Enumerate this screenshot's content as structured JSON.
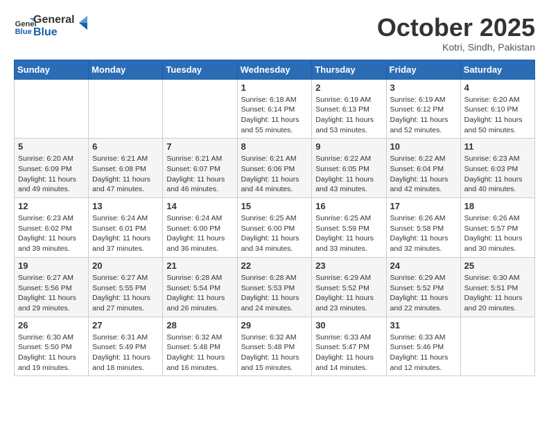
{
  "header": {
    "logo_line1": "General",
    "logo_line2": "Blue",
    "month": "October 2025",
    "location": "Kotri, Sindh, Pakistan"
  },
  "weekdays": [
    "Sunday",
    "Monday",
    "Tuesday",
    "Wednesday",
    "Thursday",
    "Friday",
    "Saturday"
  ],
  "weeks": [
    [
      {
        "day": "",
        "info": ""
      },
      {
        "day": "",
        "info": ""
      },
      {
        "day": "",
        "info": ""
      },
      {
        "day": "1",
        "info": "Sunrise: 6:18 AM\nSunset: 6:14 PM\nDaylight: 11 hours\nand 55 minutes."
      },
      {
        "day": "2",
        "info": "Sunrise: 6:19 AM\nSunset: 6:13 PM\nDaylight: 11 hours\nand 53 minutes."
      },
      {
        "day": "3",
        "info": "Sunrise: 6:19 AM\nSunset: 6:12 PM\nDaylight: 11 hours\nand 52 minutes."
      },
      {
        "day": "4",
        "info": "Sunrise: 6:20 AM\nSunset: 6:10 PM\nDaylight: 11 hours\nand 50 minutes."
      }
    ],
    [
      {
        "day": "5",
        "info": "Sunrise: 6:20 AM\nSunset: 6:09 PM\nDaylight: 11 hours\nand 49 minutes."
      },
      {
        "day": "6",
        "info": "Sunrise: 6:21 AM\nSunset: 6:08 PM\nDaylight: 11 hours\nand 47 minutes."
      },
      {
        "day": "7",
        "info": "Sunrise: 6:21 AM\nSunset: 6:07 PM\nDaylight: 11 hours\nand 46 minutes."
      },
      {
        "day": "8",
        "info": "Sunrise: 6:21 AM\nSunset: 6:06 PM\nDaylight: 11 hours\nand 44 minutes."
      },
      {
        "day": "9",
        "info": "Sunrise: 6:22 AM\nSunset: 6:05 PM\nDaylight: 11 hours\nand 43 minutes."
      },
      {
        "day": "10",
        "info": "Sunrise: 6:22 AM\nSunset: 6:04 PM\nDaylight: 11 hours\nand 42 minutes."
      },
      {
        "day": "11",
        "info": "Sunrise: 6:23 AM\nSunset: 6:03 PM\nDaylight: 11 hours\nand 40 minutes."
      }
    ],
    [
      {
        "day": "12",
        "info": "Sunrise: 6:23 AM\nSunset: 6:02 PM\nDaylight: 11 hours\nand 39 minutes."
      },
      {
        "day": "13",
        "info": "Sunrise: 6:24 AM\nSunset: 6:01 PM\nDaylight: 11 hours\nand 37 minutes."
      },
      {
        "day": "14",
        "info": "Sunrise: 6:24 AM\nSunset: 6:00 PM\nDaylight: 11 hours\nand 36 minutes."
      },
      {
        "day": "15",
        "info": "Sunrise: 6:25 AM\nSunset: 6:00 PM\nDaylight: 11 hours\nand 34 minutes."
      },
      {
        "day": "16",
        "info": "Sunrise: 6:25 AM\nSunset: 5:59 PM\nDaylight: 11 hours\nand 33 minutes."
      },
      {
        "day": "17",
        "info": "Sunrise: 6:26 AM\nSunset: 5:58 PM\nDaylight: 11 hours\nand 32 minutes."
      },
      {
        "day": "18",
        "info": "Sunrise: 6:26 AM\nSunset: 5:57 PM\nDaylight: 11 hours\nand 30 minutes."
      }
    ],
    [
      {
        "day": "19",
        "info": "Sunrise: 6:27 AM\nSunset: 5:56 PM\nDaylight: 11 hours\nand 29 minutes."
      },
      {
        "day": "20",
        "info": "Sunrise: 6:27 AM\nSunset: 5:55 PM\nDaylight: 11 hours\nand 27 minutes."
      },
      {
        "day": "21",
        "info": "Sunrise: 6:28 AM\nSunset: 5:54 PM\nDaylight: 11 hours\nand 26 minutes."
      },
      {
        "day": "22",
        "info": "Sunrise: 6:28 AM\nSunset: 5:53 PM\nDaylight: 11 hours\nand 24 minutes."
      },
      {
        "day": "23",
        "info": "Sunrise: 6:29 AM\nSunset: 5:52 PM\nDaylight: 11 hours\nand 23 minutes."
      },
      {
        "day": "24",
        "info": "Sunrise: 6:29 AM\nSunset: 5:52 PM\nDaylight: 11 hours\nand 22 minutes."
      },
      {
        "day": "25",
        "info": "Sunrise: 6:30 AM\nSunset: 5:51 PM\nDaylight: 11 hours\nand 20 minutes."
      }
    ],
    [
      {
        "day": "26",
        "info": "Sunrise: 6:30 AM\nSunset: 5:50 PM\nDaylight: 11 hours\nand 19 minutes."
      },
      {
        "day": "27",
        "info": "Sunrise: 6:31 AM\nSunset: 5:49 PM\nDaylight: 11 hours\nand 18 minutes."
      },
      {
        "day": "28",
        "info": "Sunrise: 6:32 AM\nSunset: 5:48 PM\nDaylight: 11 hours\nand 16 minutes."
      },
      {
        "day": "29",
        "info": "Sunrise: 6:32 AM\nSunset: 5:48 PM\nDaylight: 11 hours\nand 15 minutes."
      },
      {
        "day": "30",
        "info": "Sunrise: 6:33 AM\nSunset: 5:47 PM\nDaylight: 11 hours\nand 14 minutes."
      },
      {
        "day": "31",
        "info": "Sunrise: 6:33 AM\nSunset: 5:46 PM\nDaylight: 11 hours\nand 12 minutes."
      },
      {
        "day": "",
        "info": ""
      }
    ]
  ]
}
